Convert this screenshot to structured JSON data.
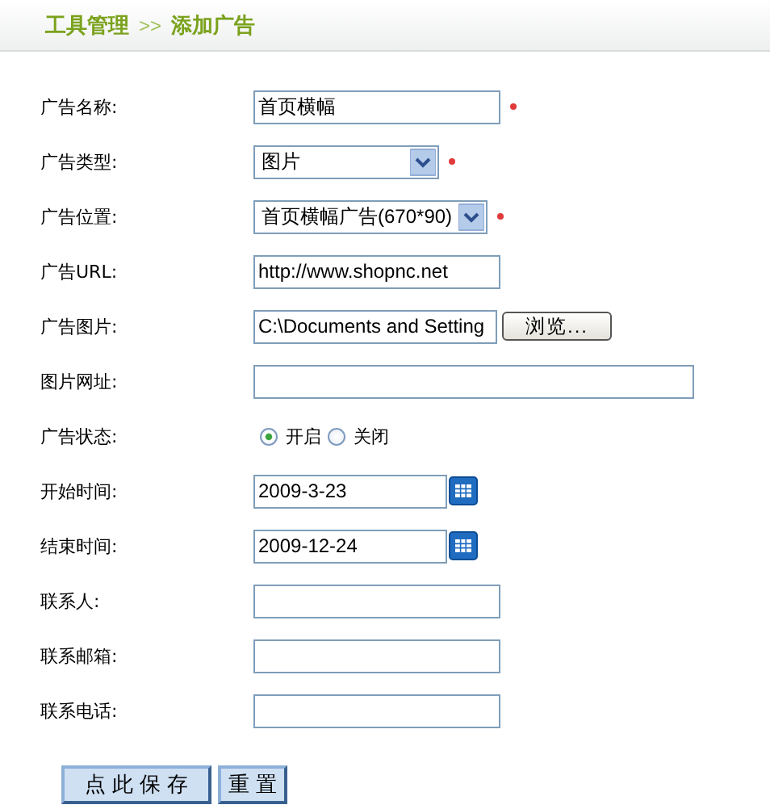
{
  "breadcrumb": {
    "section": "工具管理",
    "separator": ">>",
    "page": "添加广告"
  },
  "fields": [
    {
      "kind": "text",
      "label": "广告名称:",
      "value": "首页横幅",
      "required": true
    },
    {
      "kind": "select",
      "label": "广告类型:",
      "value": "图片",
      "required": true
    },
    {
      "kind": "select",
      "label": "广告位置:",
      "value": "首页横幅广告(670*90)",
      "required": true
    },
    {
      "kind": "text",
      "label": "广告URL:",
      "value": "http://www.shopnc.net"
    },
    {
      "kind": "file",
      "label": "广告图片:",
      "value": "C:\\Documents and Setting",
      "button": "浏览..."
    },
    {
      "kind": "long-text",
      "label": "图片网址:"
    },
    {
      "kind": "radio",
      "label": "广告状态:",
      "options": [
        {
          "label": "开启",
          "selected": true
        },
        {
          "label": "关闭",
          "selected": false
        }
      ]
    },
    {
      "kind": "date",
      "label": "开始时间:",
      "value": "2009-3-23"
    },
    {
      "kind": "date",
      "label": "结束时间:",
      "value": "2009-12-24"
    },
    {
      "kind": "text",
      "label": "联系人:"
    },
    {
      "kind": "text",
      "label": "联系邮箱:"
    },
    {
      "kind": "text",
      "label": "联系电话:"
    }
  ],
  "buttons": [
    {
      "label": "点 此 保 存",
      "kind": "primary"
    },
    {
      "label": "重 置",
      "kind": "secondary"
    }
  ]
}
